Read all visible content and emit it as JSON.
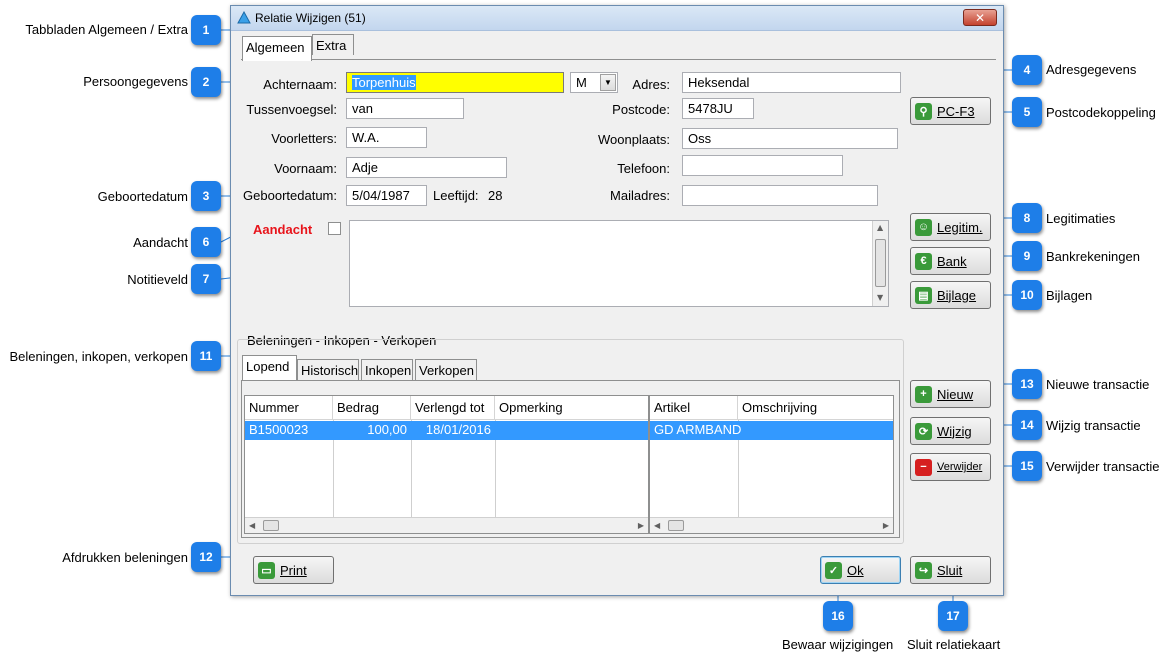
{
  "window": {
    "title": "Relatie Wijzigen  (51)",
    "close_glyph": "✕"
  },
  "tabs_main": [
    "Algemeen",
    "Extra"
  ],
  "form": {
    "achternaam_label": "Achternaam:",
    "achternaam_value": "Torpenhuis",
    "gender_value": "M",
    "tussenvoegsel_label": "Tussenvoegsel:",
    "tussenvoegsel_value": "van",
    "voorletters_label": "Voorletters:",
    "voorletters_value": "W.A.",
    "voornaam_label": "Voornaam:",
    "voornaam_value": "Adje",
    "geboortedatum_label": "Geboortedatum:",
    "geboortedatum_value": "5/04/1987",
    "leeftijd_label": "Leeftijd:",
    "leeftijd_value": "28",
    "adres_label": "Adres:",
    "adres_value": "Heksendal",
    "postcode_label": "Postcode:",
    "postcode_value": "5478JU",
    "woonplaats_label": "Woonplaats:",
    "woonplaats_value": "Oss",
    "telefoon_label": "Telefoon:",
    "telefoon_value": "",
    "mailadres_label": "Mailadres:",
    "mailadres_value": "",
    "aandacht_label": "Aandacht",
    "notes_value": ""
  },
  "buttons": {
    "pcf3": "PC-F3",
    "legitim": "Legitim.",
    "bank": "Bank",
    "bijlage": "Bijlage",
    "nieuw": "Nieuw",
    "wijzig": "Wijzig",
    "verwijder": "Verwijder",
    "print": "Print",
    "ok": "Ok",
    "sluit": "Sluit"
  },
  "transactions": {
    "group_label": "Beleningen - Inkopen - Verkopen",
    "tabs": [
      "Lopend",
      "Historisch",
      "Inkopen",
      "Verkopen"
    ],
    "columns": [
      "Nummer",
      "Bedrag",
      "Verlengd tot",
      "Opmerking"
    ],
    "rows": [
      {
        "nummer": "B1500023",
        "bedrag": "100,00",
        "verlengd": "18/01/2016",
        "opmerking": ""
      }
    ],
    "detail_columns": [
      "Artikel",
      "Omschrijving"
    ],
    "detail_rows": [
      {
        "artikel": "GD ARMBAND",
        "omschrijving": ""
      }
    ]
  },
  "callouts": [
    {
      "num": "1",
      "label": "Tabbladen Algemeen / Extra"
    },
    {
      "num": "2",
      "label": "Persoongegevens"
    },
    {
      "num": "3",
      "label": "Geboortedatum"
    },
    {
      "num": "4",
      "label": "Adresgegevens"
    },
    {
      "num": "5",
      "label": "Postcodekoppeling"
    },
    {
      "num": "6",
      "label": "Aandacht"
    },
    {
      "num": "7",
      "label": "Notitieveld"
    },
    {
      "num": "8",
      "label": "Legitimaties"
    },
    {
      "num": "9",
      "label": "Bankrekeningen"
    },
    {
      "num": "10",
      "label": "Bijlagen"
    },
    {
      "num": "11",
      "label": "Beleningen, inkopen, verkopen"
    },
    {
      "num": "12",
      "label": "Afdrukken beleningen"
    },
    {
      "num": "13",
      "label": "Nieuwe transactie"
    },
    {
      "num": "14",
      "label": "Wijzig transactie"
    },
    {
      "num": "15",
      "label": "Verwijder transactie"
    },
    {
      "num": "16",
      "label": "Bewaar wijzigingen"
    },
    {
      "num": "17",
      "label": "Sluit relatiekaart"
    }
  ],
  "colors": {
    "callout": "#1e7ee8",
    "selection": "#3399ff",
    "highlight_field": "#ffff00",
    "aandacht": "#e8141b"
  }
}
